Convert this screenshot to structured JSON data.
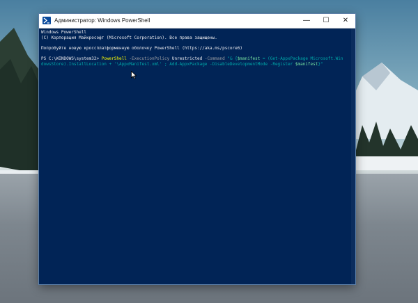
{
  "window": {
    "title": "Администратор: Windows PowerShell",
    "minimize_glyph": "—",
    "maximize_glyph": "☐",
    "close_glyph": "✕"
  },
  "console": {
    "line1": "Windows PowerShell",
    "line2": "(C) Корпорация Майкрософт (Microsoft Corporation). Все права защищены.",
    "line3": "Попробуйте новую кроссплатформенную оболочку PowerShell (https://aka.ms/pscore6)",
    "prompt": "PS C:\\WINDOWS\\system32> ",
    "cmd_name": "PowerShell",
    "cmd_p1": " -ExecutionPolicy ",
    "cmd_v1": "Unrestricted",
    "cmd_p2": " -Command ",
    "cmd_str1": "\"& {",
    "cmd_var1": "$manifest",
    "cmd_str2": " = (Get-AppxPackage Microsoft.Win",
    "wrap_line": "dowsStore).InstallLocation + '\\AppxManifest.xml' ; Add-AppxPackage -DisableDevelopmentMode -Register ",
    "wrap_var": "$manifest",
    "wrap_end": "}\""
  },
  "colors": {
    "console_bg": "#012456",
    "console_fg": "#eeedf0",
    "cmdlet": "#ffff00",
    "param": "#9fa0a3",
    "string": "#00aaaa",
    "variable": "#79e7a3"
  }
}
